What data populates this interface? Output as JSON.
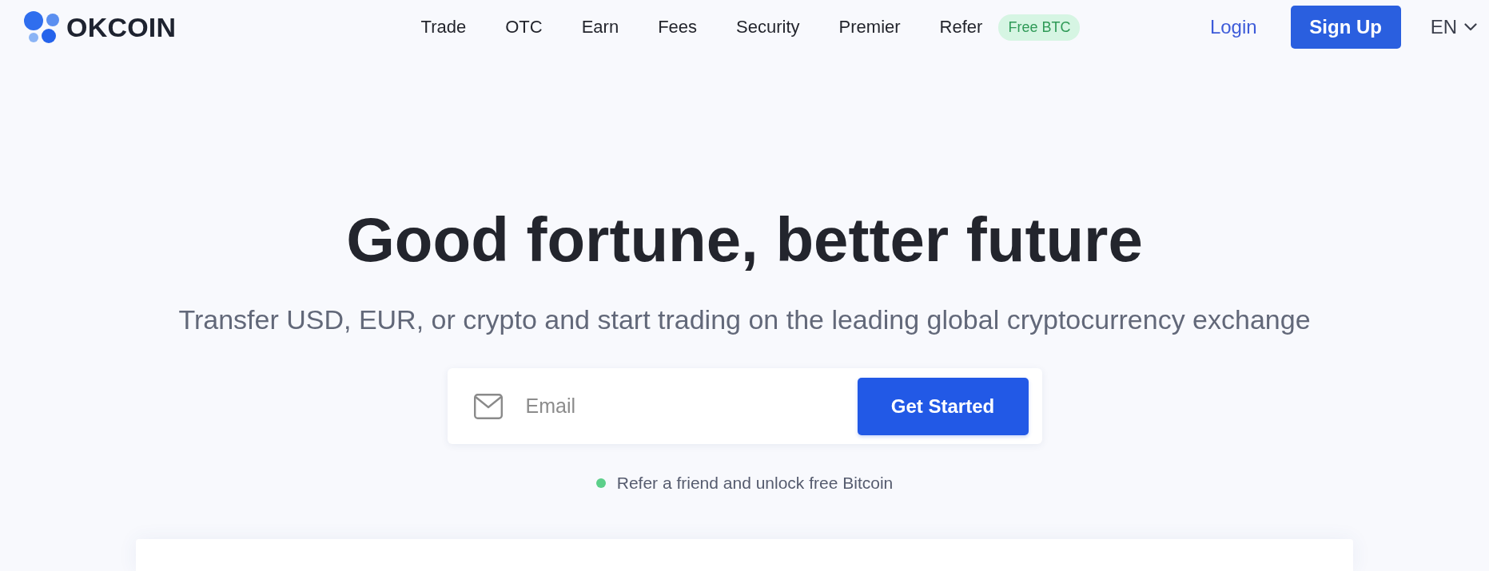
{
  "header": {
    "logo": {
      "text": "OKCOIN"
    },
    "nav": [
      {
        "label": "Trade"
      },
      {
        "label": "OTC"
      },
      {
        "label": "Earn"
      },
      {
        "label": "Fees"
      },
      {
        "label": "Security"
      },
      {
        "label": "Premier"
      },
      {
        "label": "Refer",
        "badge": "Free BTC"
      }
    ],
    "login": "Login",
    "sign_up": "Sign Up",
    "language": "EN"
  },
  "hero": {
    "title": "Good fortune, better future",
    "subtitle": "Transfer USD, EUR, or crypto and start trading on the leading global cryptocurrency exchange",
    "email_form": {
      "placeholder": "Email",
      "button": "Get Started"
    },
    "referral": "Refer a friend and unlock free Bitcoin"
  }
}
